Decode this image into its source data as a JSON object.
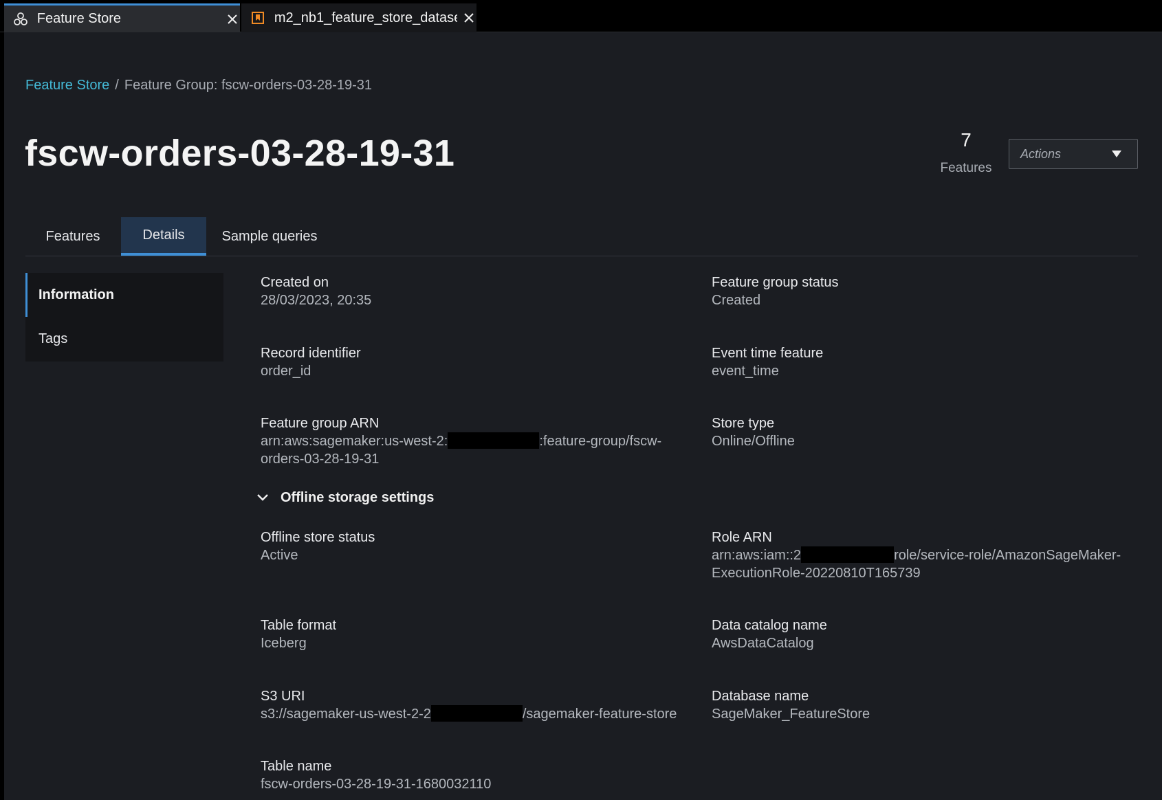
{
  "tabs": [
    {
      "label": "Feature Store",
      "icon": "feature-store-icon"
    },
    {
      "label": "m2_nb1_feature_store_datase",
      "icon": "notebook-icon"
    }
  ],
  "breadcrumb": {
    "root": "Feature Store",
    "separator": "/",
    "current": "Feature Group: fscw-orders-03-28-19-31"
  },
  "title": "fscw-orders-03-28-19-31",
  "features_count": {
    "value": "7",
    "label": "Features"
  },
  "actions": {
    "label": "Actions"
  },
  "page_tabs": [
    {
      "label": "Features"
    },
    {
      "label": "Details",
      "active": true
    },
    {
      "label": "Sample queries"
    }
  ],
  "side_nav": [
    {
      "label": "Information",
      "active": true
    },
    {
      "label": "Tags"
    }
  ],
  "info": {
    "created_on": {
      "label": "Created on",
      "value": "28/03/2023, 20:35"
    },
    "status": {
      "label": "Feature group status",
      "value": "Created"
    },
    "record_identifier": {
      "label": "Record identifier",
      "value": "order_id"
    },
    "event_time": {
      "label": "Event time feature",
      "value": "event_time"
    },
    "arn": {
      "label": "Feature group ARN",
      "value_prefix": "arn:aws:sagemaker:us-west-2:",
      "value_suffix": ":feature-group/fscw-",
      "value_line2": "orders-03-28-19-31"
    },
    "store_type": {
      "label": "Store type",
      "value": "Online/Offline"
    }
  },
  "offline": {
    "section_label": "Offline storage settings",
    "status": {
      "label": "Offline store status",
      "value": "Active"
    },
    "role_arn": {
      "label": "Role ARN",
      "value_prefix": "arn:aws:iam::2",
      "value_suffix": "role/service-role/AmazonSageMaker-",
      "value_line2": "ExecutionRole-20220810T165739"
    },
    "table_format": {
      "label": "Table format",
      "value": "Iceberg"
    },
    "catalog": {
      "label": "Data catalog name",
      "value": "AwsDataCatalog"
    },
    "s3_uri": {
      "label": "S3 URI",
      "value_prefix": "s3://sagemaker-us-west-2-2",
      "value_suffix": "/sagemaker-feature-store"
    },
    "database": {
      "label": "Database name",
      "value": "SageMaker_FeatureStore"
    },
    "table_name": {
      "label": "Table name",
      "value": "fscw-orders-03-28-19-31-1680032110"
    }
  },
  "colors": {
    "accent": "#3f8fd6",
    "link": "#44b9d6",
    "background": "#1b1d22"
  }
}
